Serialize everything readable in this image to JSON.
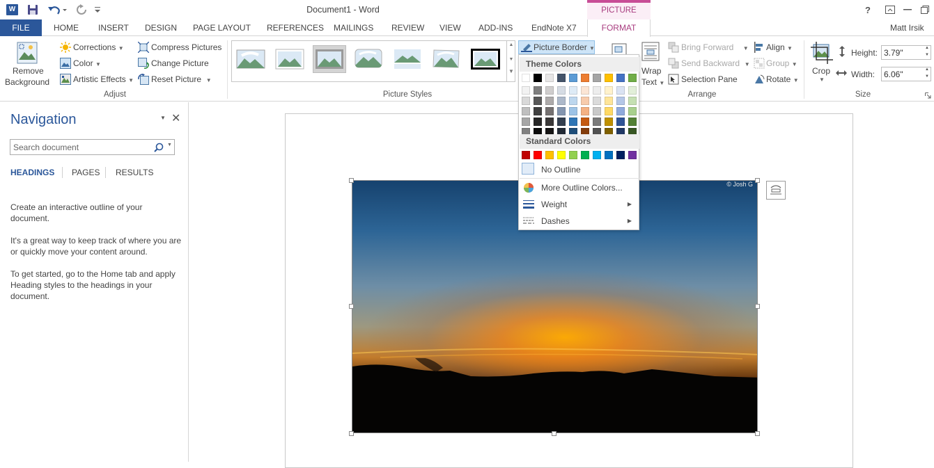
{
  "window": {
    "title": "Document1 - Word",
    "user": "Matt Irsik",
    "help": "?",
    "restore_icon": "restore-icon"
  },
  "contextual_tab_group": "PICTURE TOOLS",
  "tabs": [
    "FILE",
    "HOME",
    "INSERT",
    "DESIGN",
    "PAGE LAYOUT",
    "REFERENCES",
    "MAILINGS",
    "REVIEW",
    "VIEW",
    "ADD-INS",
    "EndNote X7",
    "FORMAT"
  ],
  "ribbon": {
    "adjust": {
      "label": "Adjust",
      "remove_background": [
        "Remove",
        "Background"
      ],
      "corrections": "Corrections",
      "color": "Color",
      "artistic_effects": "Artistic Effects",
      "compress_pictures": "Compress Pictures",
      "change_picture": "Change Picture",
      "reset_picture": "Reset Picture"
    },
    "picture_styles": {
      "label": "Picture Styles",
      "picture_border": "Picture Border"
    },
    "arrange": {
      "label": "Arrange",
      "wrap_text": [
        "Wrap",
        "Text"
      ],
      "bring_forward": "Bring Forward",
      "send_backward": "Send Backward",
      "selection_pane": "Selection Pane",
      "align": "Align",
      "group": "Group",
      "rotate": "Rotate"
    },
    "size": {
      "label": "Size",
      "crop": "Crop",
      "height_label": "Height:",
      "height_value": "3.79\"",
      "width_label": "Width:",
      "width_value": "6.06\""
    }
  },
  "navigation": {
    "title": "Navigation",
    "search_placeholder": "Search document",
    "tabs": [
      "HEADINGS",
      "PAGES",
      "RESULTS"
    ],
    "paragraphs": [
      "Create an interactive outline of your document.",
      "It's a great way to keep track of where you are or quickly move your content around.",
      "To get started, go to the Home tab and apply Heading styles to the headings in your document."
    ]
  },
  "picture": {
    "copyright": "© Josh G"
  },
  "dropdown": {
    "theme_colors_label": "Theme Colors",
    "theme_colors": [
      [
        "#ffffff",
        "#f2f2f2",
        "#d9d9d9",
        "#bfbfbf",
        "#a6a6a6",
        "#808080"
      ],
      [
        "#000000",
        "#7f7f7f",
        "#595959",
        "#404040",
        "#262626",
        "#0d0d0d"
      ],
      [
        "#e7e6e6",
        "#d0cece",
        "#aeabab",
        "#757171",
        "#3a3838",
        "#171616"
      ],
      [
        "#44546a",
        "#d6dce4",
        "#adb9ca",
        "#8496b0",
        "#333f4f",
        "#222a35"
      ],
      [
        "#5b9bd5",
        "#deebf6",
        "#bdd7ee",
        "#9dc3e6",
        "#2e75b5",
        "#1f4e79"
      ],
      [
        "#ed7d31",
        "#fbe5d5",
        "#f7cbac",
        "#f4b183",
        "#c55a11",
        "#833c0b"
      ],
      [
        "#a5a5a5",
        "#ededed",
        "#dbdbdb",
        "#c9c9c9",
        "#7b7b7b",
        "#525252"
      ],
      [
        "#ffc000",
        "#fff2cc",
        "#fee599",
        "#ffd965",
        "#bf9000",
        "#7f6000"
      ],
      [
        "#4472c4",
        "#dae3f3",
        "#b4c7e7",
        "#8faadc",
        "#2f5496",
        "#203864"
      ],
      [
        "#70ad47",
        "#e2efd9",
        "#c5e0b3",
        "#a8d08d",
        "#538135",
        "#375623"
      ]
    ],
    "standard_colors_label": "Standard Colors",
    "standard_colors": [
      "#c00000",
      "#ff0000",
      "#ffc000",
      "#ffff00",
      "#92d050",
      "#00b050",
      "#00b0f0",
      "#0070c0",
      "#002060",
      "#7030a0"
    ],
    "no_outline": "No Outline",
    "more_outline_colors": "More Outline Colors...",
    "weight": "Weight",
    "dashes": "Dashes"
  }
}
